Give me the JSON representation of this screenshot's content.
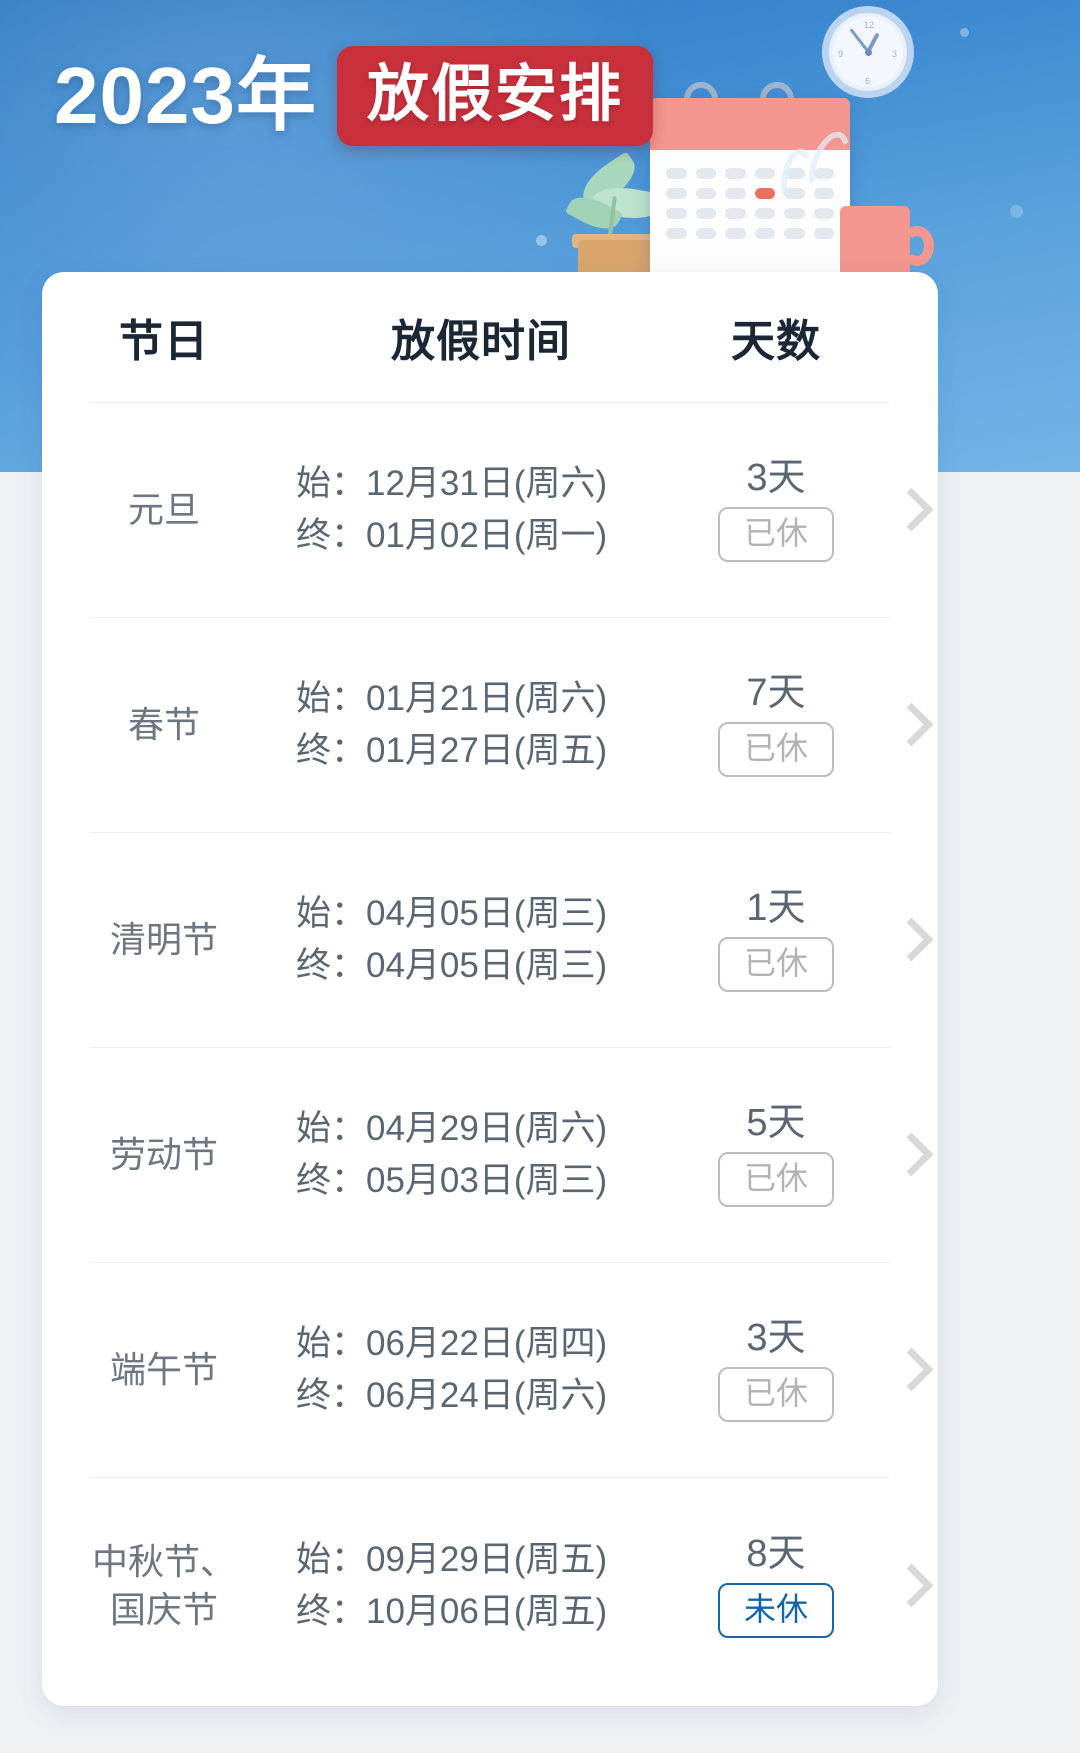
{
  "hero": {
    "year_label": "2023年",
    "badge_label": "放假安排",
    "clock_number": "12",
    "accent_red": "#c8303c",
    "accent_blue": "#1464ab",
    "hero_bg": "#3d8ad1"
  },
  "table": {
    "headers": {
      "holiday": "节日",
      "period": "放假时间",
      "days": "天数"
    },
    "rows": [
      {
        "holiday": "元旦",
        "start": "始：12月31日(周六)",
        "end": "终：01月02日(周一)",
        "days": "3天",
        "status": "已休",
        "status_state": "rested"
      },
      {
        "holiday": "春节",
        "start": "始：01月21日(周六)",
        "end": "终：01月27日(周五)",
        "days": "7天",
        "status": "已休",
        "status_state": "rested"
      },
      {
        "holiday": "清明节",
        "start": "始：04月05日(周三)",
        "end": "终：04月05日(周三)",
        "days": "1天",
        "status": "已休",
        "status_state": "rested"
      },
      {
        "holiday": "劳动节",
        "start": "始：04月29日(周六)",
        "end": "终：05月03日(周三)",
        "days": "5天",
        "status": "已休",
        "status_state": "rested"
      },
      {
        "holiday": "端午节",
        "start": "始：06月22日(周四)",
        "end": "终：06月24日(周六)",
        "days": "3天",
        "status": "已休",
        "status_state": "rested"
      },
      {
        "holiday": "中秋节、\n国庆节",
        "start": "始：09月29日(周五)",
        "end": "终：10月06日(周五)",
        "days": "8天",
        "status": "未休",
        "status_state": "unrested"
      }
    ]
  },
  "icons": {
    "chevron_right": "chevron-right-icon",
    "calendar": "calendar-icon",
    "clock": "clock-icon",
    "plant": "plant-icon",
    "mug": "coffee-mug-icon"
  }
}
